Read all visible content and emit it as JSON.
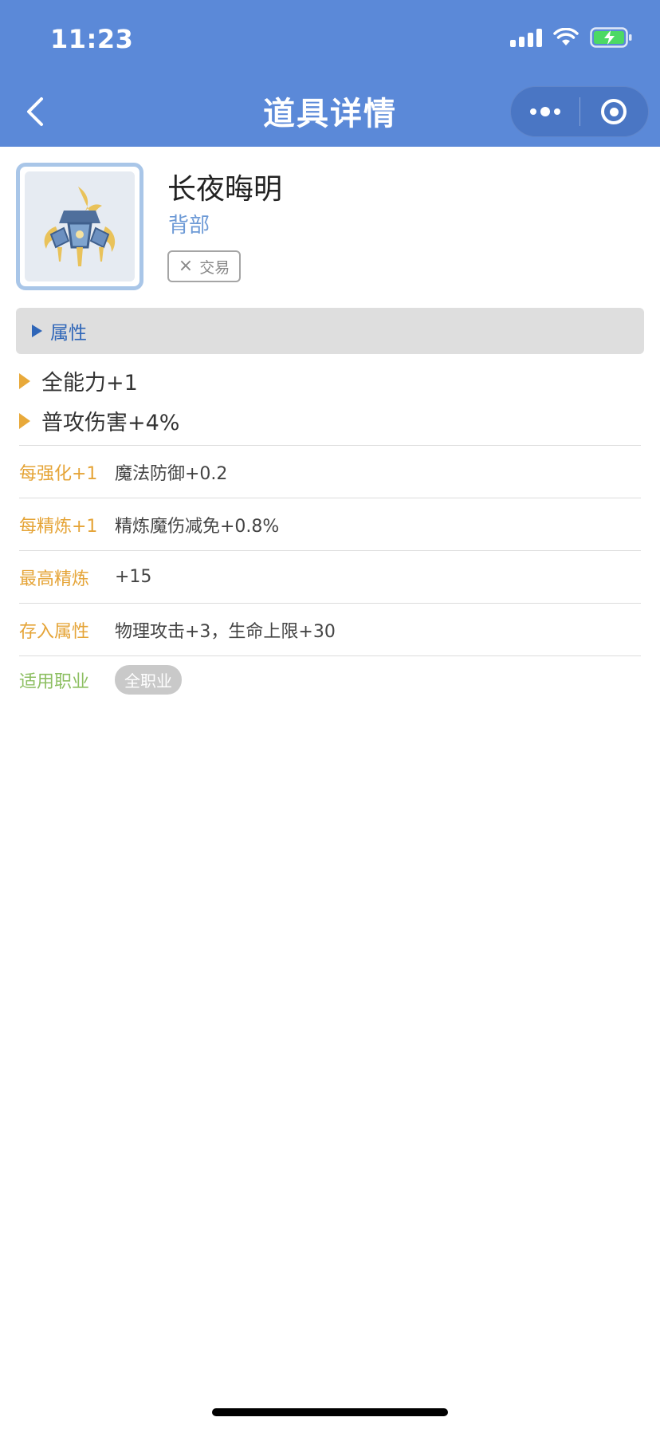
{
  "status_bar": {
    "time": "11:23"
  },
  "nav": {
    "title": "道具详情"
  },
  "item": {
    "name": "长夜晦明",
    "slot": "背部",
    "trade_tag": "交易",
    "trade_mark": "×"
  },
  "attributes": {
    "section_label": "属性",
    "lines": [
      "全能力+1",
      "普攻伤害+4%"
    ]
  },
  "details": [
    {
      "label": "每强化+1",
      "value": "魔法防御+0.2"
    },
    {
      "label": "每精炼+1",
      "value": "精炼魔伤减免+0.8%"
    },
    {
      "label": "最高精炼",
      "value": "+15"
    },
    {
      "label": "存入属性",
      "value": "物理攻击+3，生命上限+30"
    }
  ],
  "class_row": {
    "label": "适用职业",
    "value": "全职业"
  },
  "colors": {
    "header_bg": "#5b89d8",
    "accent_orange": "#e5a437",
    "accent_green": "#8dbf62",
    "accent_blue": "#2f66b8"
  }
}
